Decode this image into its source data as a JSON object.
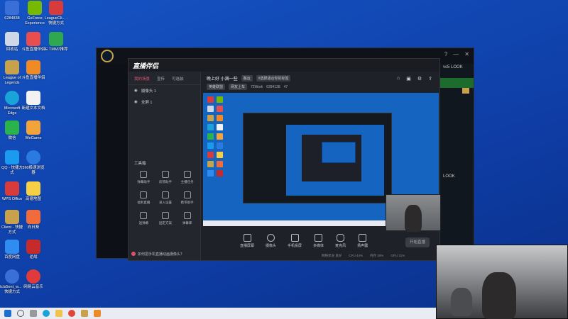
{
  "desktop": {
    "icons": [
      {
        "label": "6284838",
        "color": "#3a6fd8"
      },
      {
        "label": "GeForce Experience",
        "color": "#76b900"
      },
      {
        "label": "LeagueCli... - 快捷方式",
        "color": "#d83b3b"
      },
      {
        "label": "回收站",
        "color": "#cfd8e6"
      },
      {
        "label": "斗鱼直播伴侣",
        "color": "#e94e4e"
      },
      {
        "label": "IE TMM7推荐",
        "color": "#2fa84f"
      },
      {
        "label": "League of Legends",
        "color": "#c8a24a"
      },
      {
        "label": "斗鱼直播伴侣",
        "color": "#f08a24"
      },
      {
        "label": "Microsoft Edge",
        "color": "#1aa3d9"
      },
      {
        "label": "新建文本文档",
        "color": "#f2f2f2"
      },
      {
        "label": "微信",
        "color": "#2ab34a"
      },
      {
        "label": "WeGame",
        "color": "#f2a33a"
      },
      {
        "label": "QQ - 快捷方式",
        "color": "#1b9bef"
      },
      {
        "label": "360极速浏览器",
        "color": "#2a7ae2"
      },
      {
        "label": "WPS Office",
        "color": "#d83b3b"
      },
      {
        "label": "高德地图",
        "color": "#f5d046"
      },
      {
        "label": "Client - 快捷方式",
        "color": "#c8a24a"
      },
      {
        "label": "向日葵",
        "color": "#f26b3a"
      },
      {
        "label": "百度网盘",
        "color": "#2f8cf0"
      },
      {
        "label": "逆战",
        "color": "#c72a2a"
      },
      {
        "label": "tcls5ent_w... - 快捷方式",
        "color": "#3a6fd8"
      },
      {
        "label": "网易云音乐",
        "color": "#e03a3a"
      }
    ]
  },
  "game_window": {
    "right_text": [
      "vs5 LOOK",
      "LOOK"
    ],
    "controls": [
      "?",
      "—",
      "✕"
    ]
  },
  "app": {
    "logo": "直播伴侣",
    "tabs": [
      "我的场景",
      "宣传",
      "可选装"
    ],
    "scenes": [
      "摄像头 1",
      "全屏 1"
    ],
    "room_title": "晚上好 小满一些",
    "chips": [
      "搬运",
      "#选择适合你的标签"
    ],
    "meta": [
      "英雄联盟",
      "网友上车",
      "72Work",
      "6284138",
      "47"
    ],
    "tools_title": "工具箱",
    "tools": [
      "弹幕助手",
      "房管助手",
      "主播任务",
      "福利直播",
      "录入设置",
      "携带助手",
      "送弹幕",
      "固定方案",
      "弹幕库"
    ],
    "notice": "如何把手机直播动画摄像头？",
    "controls": [
      "直播屏幕",
      "摄像头",
      "手机投屏",
      "多媒体",
      "麦克风",
      "扬声器"
    ],
    "go_live": "开始直播",
    "stats": [
      "网络状况 良好",
      "CPU 44%",
      "内存 39%",
      "GPU 31%"
    ]
  },
  "taskbar": {
    "apps": [
      "start",
      "search",
      "taskview",
      "edge",
      "explorer",
      "chrome",
      "lol",
      "douyu"
    ]
  }
}
